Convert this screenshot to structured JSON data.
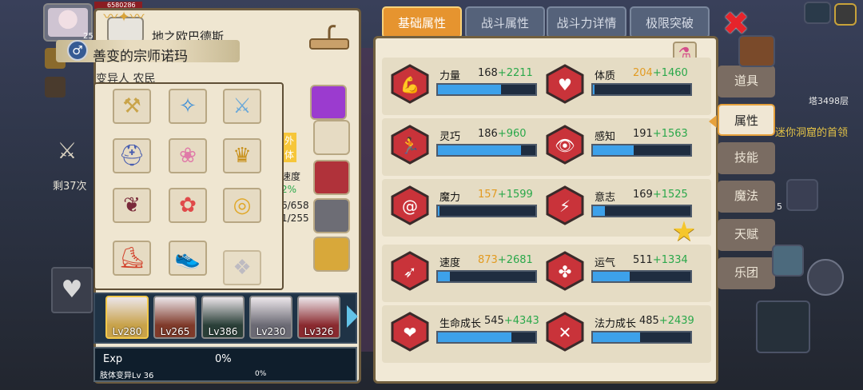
{
  "player": {
    "hp": "6580286",
    "level": "25"
  },
  "left_hud": {
    "remaining": "剩37次"
  },
  "hero": {
    "name": "地之欧巴德斯",
    "title": "善变的宗师诺玛",
    "sub_name": "变异人 农民",
    "fragments": [
      "外",
      "体",
      "速度",
      "2%",
      "6/658",
      "1/255"
    ]
  },
  "heroes": [
    {
      "lv": "Lv280",
      "color": "#c8a24a"
    },
    {
      "lv": "Lv265",
      "color": "#7f3a2a"
    },
    {
      "lv": "Lv386",
      "color": "#2a3f38"
    },
    {
      "lv": "Lv230",
      "color": "#6b6a74"
    },
    {
      "lv": "Lv326",
      "color": "#8a2a2f"
    }
  ],
  "exp": {
    "label": "Exp",
    "percent": "0%",
    "sub_label": "肢体变异Lv 36",
    "sub_percent": "0%"
  },
  "tabs": [
    {
      "label": "基础属性",
      "active": true
    },
    {
      "label": "战斗属性",
      "active": false
    },
    {
      "label": "战斗力详情",
      "active": false
    },
    {
      "label": "极限突破",
      "active": false
    }
  ],
  "stats": [
    {
      "name": "力量",
      "base": "168",
      "bonus": "+2211",
      "base_color": "normal",
      "fill": 0.65,
      "icon": "muscle-icon"
    },
    {
      "name": "体质",
      "base": "204",
      "bonus": "+1460",
      "base_color": "gold",
      "fill": 0.0,
      "icon": "body-icon"
    },
    {
      "name": "灵巧",
      "base": "186",
      "bonus": "+960",
      "base_color": "normal",
      "fill": 0.85,
      "icon": "running-icon"
    },
    {
      "name": "感知",
      "base": "191",
      "bonus": "+1563",
      "base_color": "normal",
      "fill": 0.42,
      "icon": "eye-icon"
    },
    {
      "name": "魔力",
      "base": "157",
      "bonus": "+1599",
      "base_color": "gold",
      "fill": 0.0,
      "icon": "spiral-icon"
    },
    {
      "name": "意志",
      "base": "169",
      "bonus": "+1525",
      "base_color": "normal",
      "fill": 0.12,
      "icon": "will-icon"
    },
    {
      "name": "速度",
      "base": "873",
      "bonus": "+2681",
      "base_color": "gold",
      "fill": 0.12,
      "icon": "wing-icon"
    },
    {
      "name": "运气",
      "base": "511",
      "bonus": "+1334",
      "base_color": "normal",
      "fill": 0.38,
      "icon": "clover-icon"
    },
    {
      "name": "生命成长",
      "base": "545",
      "bonus": "+4343",
      "base_color": "normal",
      "fill": 0.75,
      "icon": "heart-icon"
    },
    {
      "name": "法力成长",
      "base": "485",
      "bonus": "+2439",
      "base_color": "normal",
      "fill": 0.48,
      "icon": "magic-figure-icon"
    }
  ],
  "side_menu": [
    {
      "label": "道具",
      "active": false
    },
    {
      "label": "属性",
      "active": true
    },
    {
      "label": "技能",
      "active": false
    },
    {
      "label": "魔法",
      "active": false
    },
    {
      "label": "天赋",
      "active": false
    },
    {
      "label": "乐团",
      "active": false
    }
  ],
  "right_hud": {
    "tower": "塔3498层",
    "dungeon": "迷你洞窟的首领",
    "badge": "5"
  }
}
